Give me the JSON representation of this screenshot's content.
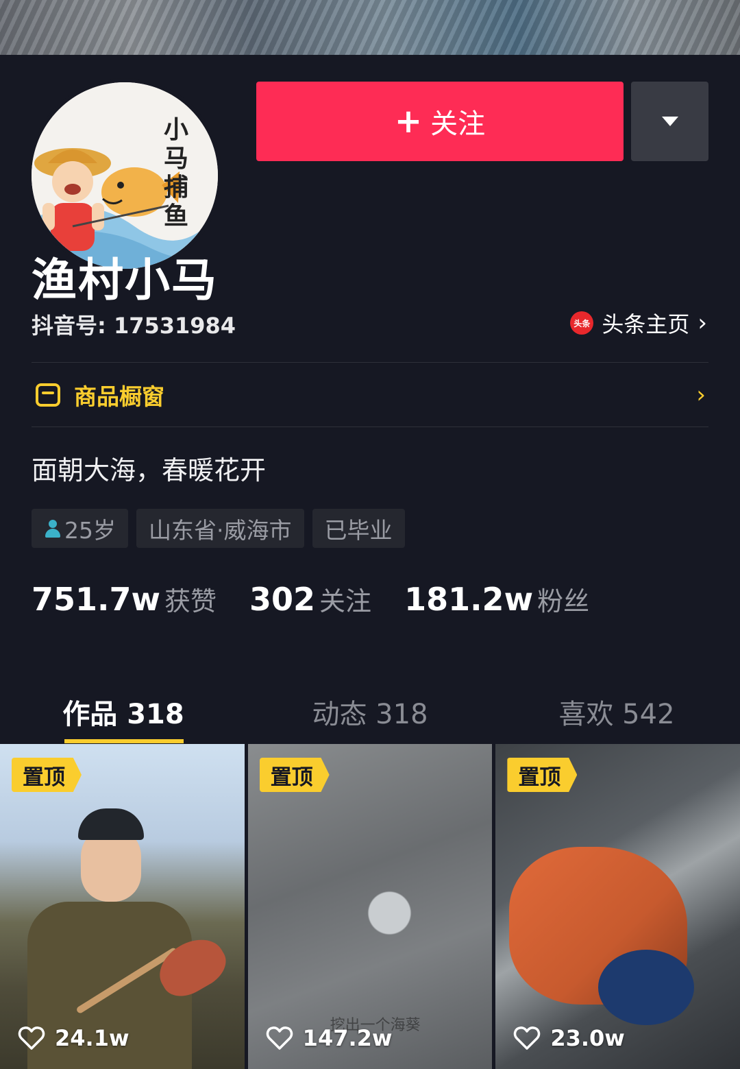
{
  "profile": {
    "avatar_text": "小马捕鱼",
    "nickname": "渔村小马",
    "douyin_id": "抖音号: 17531984",
    "toutiao_logo": "头条",
    "toutiao_label": "头条主页",
    "follow_label": "关注",
    "shop_label": "商品橱窗",
    "bio": "面朝大海，春暖花开"
  },
  "tags": [
    "25岁",
    "山东省·威海市",
    "已毕业"
  ],
  "stats": [
    {
      "num": "751.7w",
      "label": "获赞"
    },
    {
      "num": "302",
      "label": "关注"
    },
    {
      "num": "181.2w",
      "label": "粉丝"
    }
  ],
  "tabs": [
    "作品 318",
    "动态 318",
    "喜欢 542"
  ],
  "videos": [
    {
      "pin": "置顶",
      "likes": "24.1w"
    },
    {
      "pin": "置顶",
      "likes": "147.2w",
      "subtitle": "挖出一个海葵"
    },
    {
      "pin": "置顶",
      "likes": "23.0w"
    }
  ],
  "colors": {
    "accent": "#fe2c55",
    "highlight": "#facd2e",
    "background": "#161823"
  },
  "icons": {
    "follow": "plus-icon",
    "more": "triangle-down-icon",
    "shop": "shop-icon",
    "likes": "heart-icon",
    "toutiao": "toutiao-logo-icon"
  }
}
